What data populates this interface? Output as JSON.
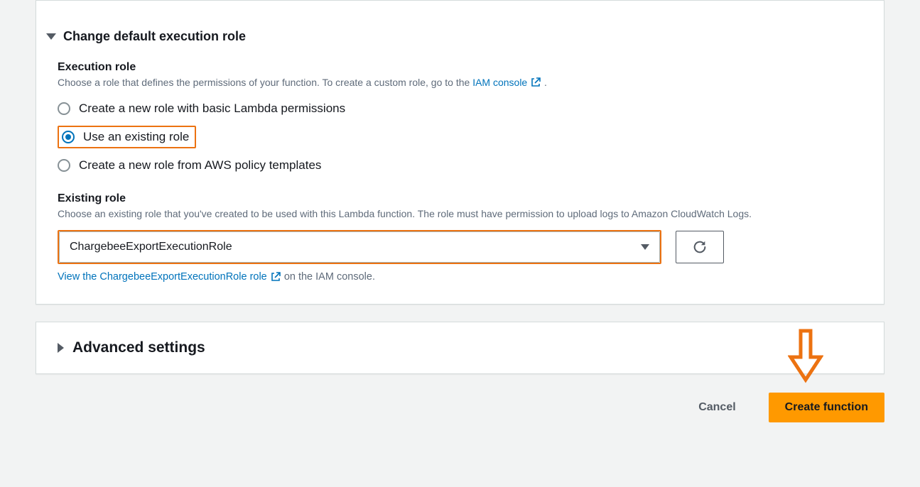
{
  "executionRolePanel": {
    "header": "Change default execution role",
    "sectionTitle": "Execution role",
    "helpPrefix": "Choose a role that defines the permissions of your function. To create a custom role, go to the ",
    "iamLinkText": "IAM console",
    "helpSuffix": ".",
    "radios": {
      "create_basic": "Create a new role with basic Lambda permissions",
      "use_existing": "Use an existing role",
      "create_templates": "Create a new role from AWS policy templates"
    },
    "existing": {
      "title": "Existing role",
      "help": "Choose an existing role that you've created to be used with this Lambda function. The role must have permission to upload logs to Amazon CloudWatch Logs.",
      "selected": "ChargebeeExportExecutionRole",
      "viewLinkText": "View the ChargebeeExportExecutionRole role",
      "viewLinkSuffix": " on the IAM console."
    }
  },
  "advanced": {
    "header": "Advanced settings"
  },
  "footer": {
    "cancel": "Cancel",
    "create": "Create function"
  }
}
